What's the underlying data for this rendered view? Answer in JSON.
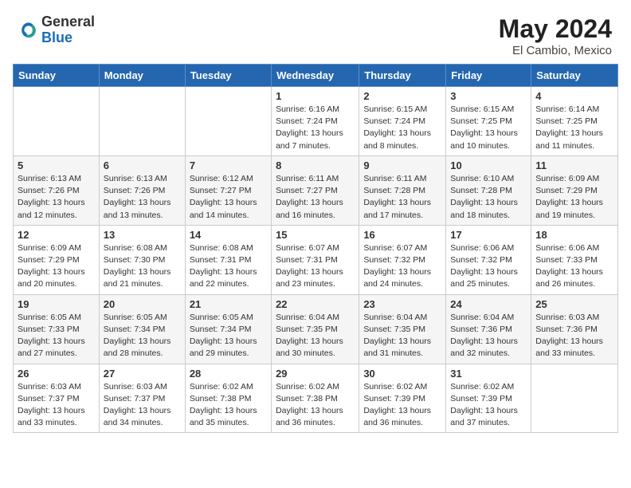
{
  "header": {
    "logo_general": "General",
    "logo_blue": "Blue",
    "month_year": "May 2024",
    "location": "El Cambio, Mexico"
  },
  "calendar": {
    "days_of_week": [
      "Sunday",
      "Monday",
      "Tuesday",
      "Wednesday",
      "Thursday",
      "Friday",
      "Saturday"
    ],
    "weeks": [
      {
        "row_alt": false,
        "days": [
          {
            "num": "",
            "info": ""
          },
          {
            "num": "",
            "info": ""
          },
          {
            "num": "",
            "info": ""
          },
          {
            "num": "1",
            "info": "Sunrise: 6:16 AM\nSunset: 7:24 PM\nDaylight: 13 hours\nand 7 minutes."
          },
          {
            "num": "2",
            "info": "Sunrise: 6:15 AM\nSunset: 7:24 PM\nDaylight: 13 hours\nand 8 minutes."
          },
          {
            "num": "3",
            "info": "Sunrise: 6:15 AM\nSunset: 7:25 PM\nDaylight: 13 hours\nand 10 minutes."
          },
          {
            "num": "4",
            "info": "Sunrise: 6:14 AM\nSunset: 7:25 PM\nDaylight: 13 hours\nand 11 minutes."
          }
        ]
      },
      {
        "row_alt": true,
        "days": [
          {
            "num": "5",
            "info": "Sunrise: 6:13 AM\nSunset: 7:26 PM\nDaylight: 13 hours\nand 12 minutes."
          },
          {
            "num": "6",
            "info": "Sunrise: 6:13 AM\nSunset: 7:26 PM\nDaylight: 13 hours\nand 13 minutes."
          },
          {
            "num": "7",
            "info": "Sunrise: 6:12 AM\nSunset: 7:27 PM\nDaylight: 13 hours\nand 14 minutes."
          },
          {
            "num": "8",
            "info": "Sunrise: 6:11 AM\nSunset: 7:27 PM\nDaylight: 13 hours\nand 16 minutes."
          },
          {
            "num": "9",
            "info": "Sunrise: 6:11 AM\nSunset: 7:28 PM\nDaylight: 13 hours\nand 17 minutes."
          },
          {
            "num": "10",
            "info": "Sunrise: 6:10 AM\nSunset: 7:28 PM\nDaylight: 13 hours\nand 18 minutes."
          },
          {
            "num": "11",
            "info": "Sunrise: 6:09 AM\nSunset: 7:29 PM\nDaylight: 13 hours\nand 19 minutes."
          }
        ]
      },
      {
        "row_alt": false,
        "days": [
          {
            "num": "12",
            "info": "Sunrise: 6:09 AM\nSunset: 7:29 PM\nDaylight: 13 hours\nand 20 minutes."
          },
          {
            "num": "13",
            "info": "Sunrise: 6:08 AM\nSunset: 7:30 PM\nDaylight: 13 hours\nand 21 minutes."
          },
          {
            "num": "14",
            "info": "Sunrise: 6:08 AM\nSunset: 7:31 PM\nDaylight: 13 hours\nand 22 minutes."
          },
          {
            "num": "15",
            "info": "Sunrise: 6:07 AM\nSunset: 7:31 PM\nDaylight: 13 hours\nand 23 minutes."
          },
          {
            "num": "16",
            "info": "Sunrise: 6:07 AM\nSunset: 7:32 PM\nDaylight: 13 hours\nand 24 minutes."
          },
          {
            "num": "17",
            "info": "Sunrise: 6:06 AM\nSunset: 7:32 PM\nDaylight: 13 hours\nand 25 minutes."
          },
          {
            "num": "18",
            "info": "Sunrise: 6:06 AM\nSunset: 7:33 PM\nDaylight: 13 hours\nand 26 minutes."
          }
        ]
      },
      {
        "row_alt": true,
        "days": [
          {
            "num": "19",
            "info": "Sunrise: 6:05 AM\nSunset: 7:33 PM\nDaylight: 13 hours\nand 27 minutes."
          },
          {
            "num": "20",
            "info": "Sunrise: 6:05 AM\nSunset: 7:34 PM\nDaylight: 13 hours\nand 28 minutes."
          },
          {
            "num": "21",
            "info": "Sunrise: 6:05 AM\nSunset: 7:34 PM\nDaylight: 13 hours\nand 29 minutes."
          },
          {
            "num": "22",
            "info": "Sunrise: 6:04 AM\nSunset: 7:35 PM\nDaylight: 13 hours\nand 30 minutes."
          },
          {
            "num": "23",
            "info": "Sunrise: 6:04 AM\nSunset: 7:35 PM\nDaylight: 13 hours\nand 31 minutes."
          },
          {
            "num": "24",
            "info": "Sunrise: 6:04 AM\nSunset: 7:36 PM\nDaylight: 13 hours\nand 32 minutes."
          },
          {
            "num": "25",
            "info": "Sunrise: 6:03 AM\nSunset: 7:36 PM\nDaylight: 13 hours\nand 33 minutes."
          }
        ]
      },
      {
        "row_alt": false,
        "days": [
          {
            "num": "26",
            "info": "Sunrise: 6:03 AM\nSunset: 7:37 PM\nDaylight: 13 hours\nand 33 minutes."
          },
          {
            "num": "27",
            "info": "Sunrise: 6:03 AM\nSunset: 7:37 PM\nDaylight: 13 hours\nand 34 minutes."
          },
          {
            "num": "28",
            "info": "Sunrise: 6:02 AM\nSunset: 7:38 PM\nDaylight: 13 hours\nand 35 minutes."
          },
          {
            "num": "29",
            "info": "Sunrise: 6:02 AM\nSunset: 7:38 PM\nDaylight: 13 hours\nand 36 minutes."
          },
          {
            "num": "30",
            "info": "Sunrise: 6:02 AM\nSunset: 7:39 PM\nDaylight: 13 hours\nand 36 minutes."
          },
          {
            "num": "31",
            "info": "Sunrise: 6:02 AM\nSunset: 7:39 PM\nDaylight: 13 hours\nand 37 minutes."
          },
          {
            "num": "",
            "info": ""
          }
        ]
      }
    ]
  }
}
